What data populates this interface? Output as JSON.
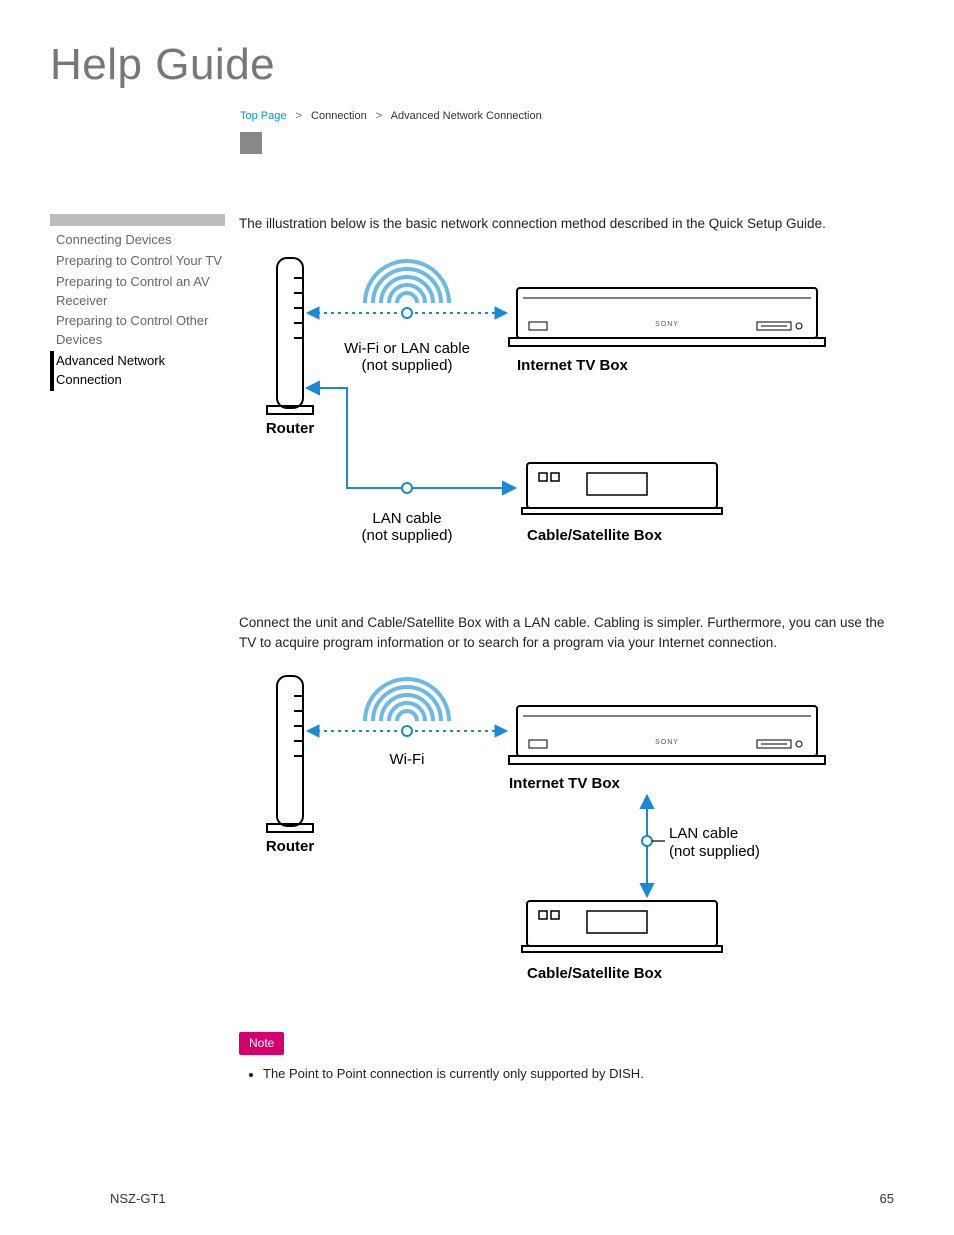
{
  "title": "Help Guide",
  "breadcrumb": {
    "link": "Top Page",
    "mid": "Connection",
    "current": "Advanced Network Connection"
  },
  "sidebar": {
    "items": [
      {
        "label": "Connecting Devices",
        "active": false
      },
      {
        "label": "Preparing to Control Your TV",
        "active": false
      },
      {
        "label": "Preparing to Control an AV Receiver",
        "active": false
      },
      {
        "label": "Preparing to Control Other Devices",
        "active": false
      },
      {
        "label": "Advanced Network Connection",
        "active": true
      }
    ]
  },
  "intro1": "The illustration below is the basic network connection method described in the Quick Setup Guide.",
  "diagram1": {
    "router": "Router",
    "wifi_lan": "Wi-Fi or LAN cable",
    "not_supplied1": "(not supplied)",
    "itv": "Internet TV Box",
    "lan": "LAN cable",
    "not_supplied2": "(not supplied)",
    "cable_box": "Cable/Satellite Box",
    "brand": "SONY"
  },
  "intro2": "Connect the unit and Cable/Satellite Box with a LAN cable. Cabling is simpler. Furthermore, you can use the TV to acquire program information or to search for a program via your Internet connection.",
  "diagram2": {
    "router": "Router",
    "wifi": "Wi-Fi",
    "itv": "Internet TV Box",
    "lan": "LAN cable",
    "not_supplied": "(not supplied)",
    "cable_box": "Cable/Satellite Box",
    "brand": "SONY"
  },
  "note_label": "Note",
  "note_item": "The Point to Point connection is currently only supported by DISH.",
  "footer": {
    "model": "NSZ-GT1",
    "page": "65"
  }
}
